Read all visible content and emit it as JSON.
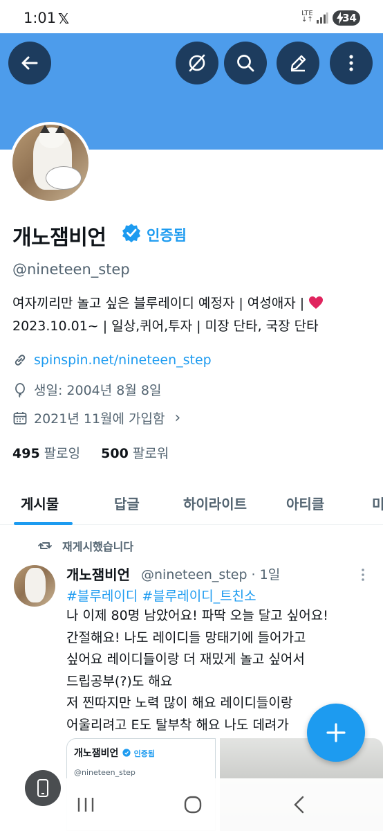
{
  "status_bar": {
    "time": "1:01",
    "network": "LTE",
    "battery": "34"
  },
  "header": {
    "icons": [
      "back-arrow-icon",
      "grok-slash-icon",
      "search-icon",
      "edit-pencil-icon",
      "more-vertical-icon"
    ],
    "banner_color": "#4d9ceb"
  },
  "profile": {
    "display_name": "개노잼비언",
    "verified_label": "인증됨",
    "handle": "@nineteen_step",
    "bio_line1": "여자끼리만 놀고 싶은 블루레이디 예정자 | 여성애자 | ",
    "bio_line2": "2023.10.01~ | 일상,퀴어,투자 | 미장 단타, 국장 단타",
    "link": "spinspin.net/nineteen_step",
    "birthday": "생일: 2004년 8월 8일",
    "joined": "2021년 11월에 가입함",
    "following_count": "495",
    "following_label": "팔로잉",
    "followers_count": "500",
    "followers_label": "팔로워"
  },
  "tabs": [
    {
      "label": "게시물",
      "active": true
    },
    {
      "label": "답글"
    },
    {
      "label": "하이라이트"
    },
    {
      "label": "아티클"
    },
    {
      "label": "미"
    }
  ],
  "tweet": {
    "repost_label": "재게시했습니다",
    "author_name": "개노잼비언",
    "author_handle_time": "@nineteen_step · 1일",
    "hashtags": "#블루레이디 #블루레이디_트친소",
    "lines": [
      "나 이제 80명 남았어요! 파딱 오늘 달고 싶어요!",
      "간절해요! 나도 레이디들 망태기에 들어가고",
      "싶어요 레이디들이랑 더 재밌게 놀고 싶어서",
      "드립공부(?)도 해요",
      "저 찐따지만 노력 많이 해요 레이디들이랑",
      "어울리려고 E도 탈부착 해요 나도 데려가"
    ],
    "embed_name": "개노잼비언",
    "embed_verified": "인증됨",
    "embed_handle": "@nineteen_step"
  },
  "colors": {
    "accent": "#1d9bf0",
    "text": "#0f1419",
    "secondary": "#536471"
  }
}
